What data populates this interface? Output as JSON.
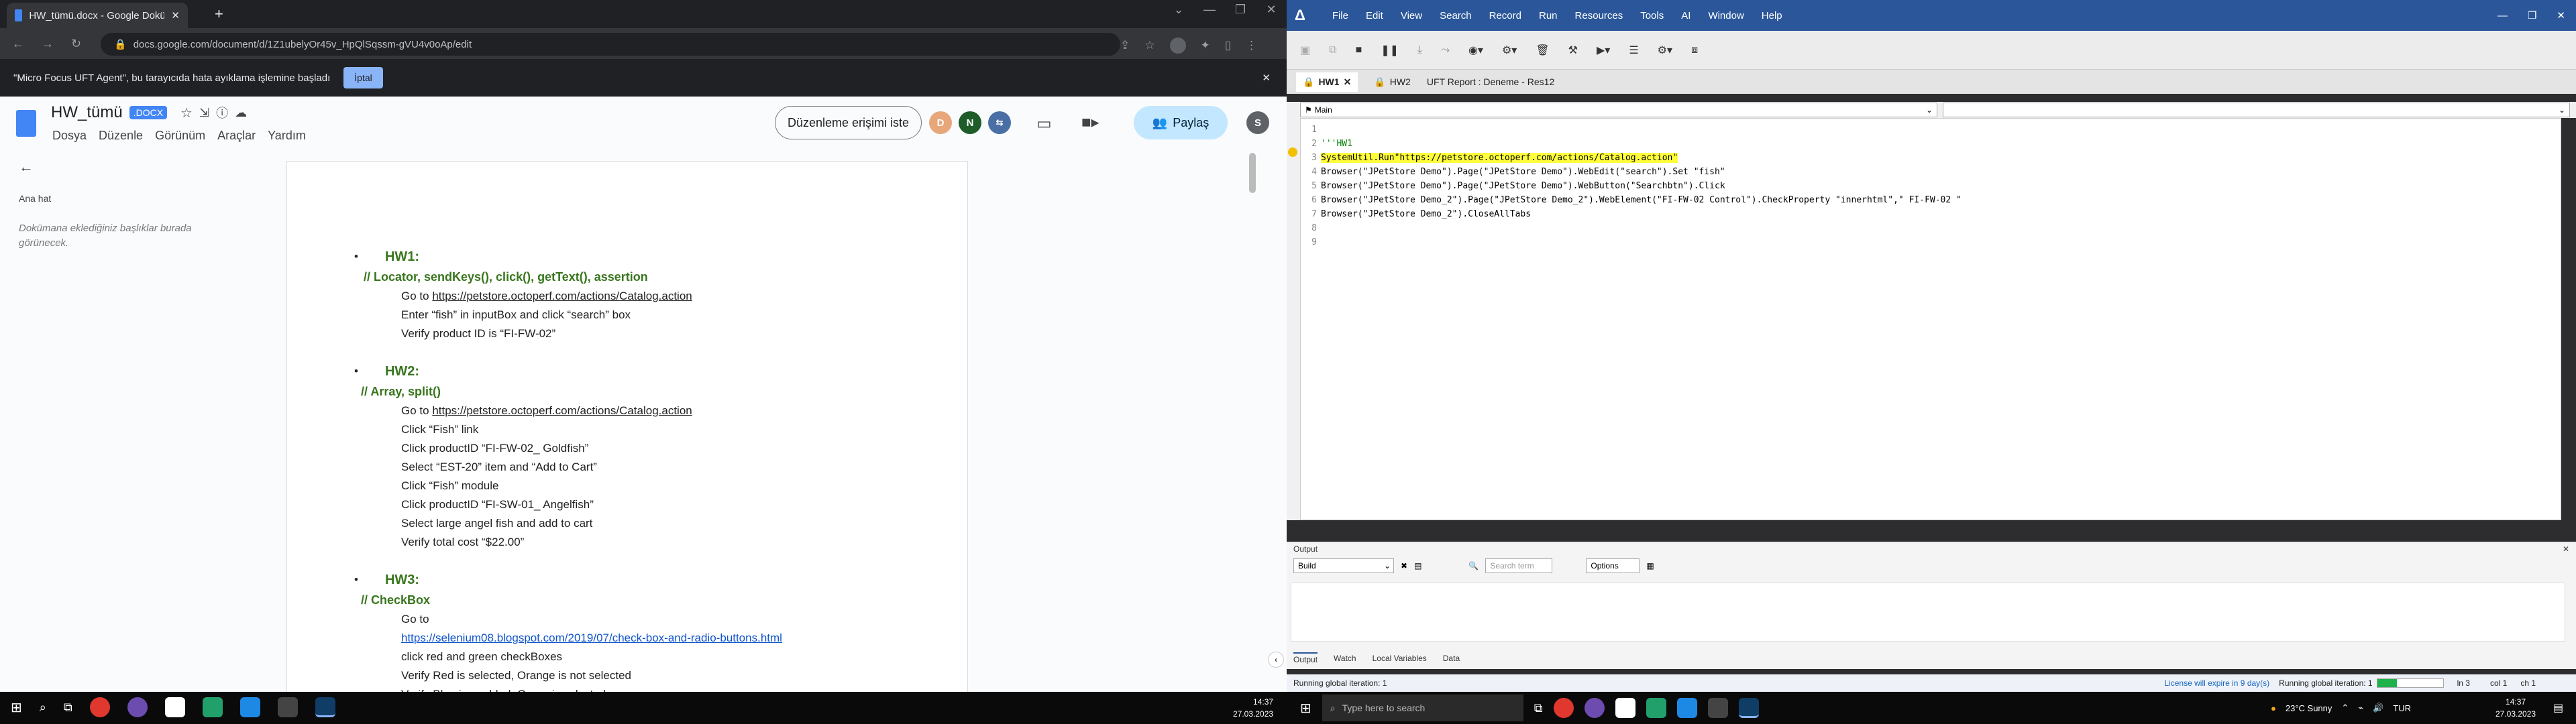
{
  "chrome": {
    "tab_title": "HW_tümü.docx - Google Dokümanlar",
    "url": "docs.google.com/document/d/1Z1ubelyOr45v_HpQlSqssm-gVU4v0oAp/edit",
    "infobar_text": "\"Micro Focus UFT Agent\", bu tarayıcıda hata ayıklama işlemine başladı",
    "infobar_cancel": "İptal"
  },
  "docs": {
    "doc_title": "HW_tümü",
    "doc_badge": ".DOCX",
    "menu": [
      "Dosya",
      "Düzenle",
      "Görünüm",
      "Araçlar",
      "Yardım"
    ],
    "request_edit": "Düzenleme erişimi iste",
    "share": "Paylaş",
    "avatar_d": "D",
    "avatar_n": "N",
    "avatar_s": "S",
    "outline_label": "Ana hat",
    "outline_hint": "Dokümana eklediğiniz başlıklar burada görünecek."
  },
  "document": {
    "hw1_title": "HW1:",
    "hw1_sub": "// Locator, sendKeys(), click(), getText(), assertion",
    "hw1_lines": [
      "Go to ",
      "Enter “fish” in inputBox and click “search” box",
      "Verify product ID is “FI-FW-02”"
    ],
    "hw1_link": "https://petstore.octoperf.com/actions/Catalog.action",
    "hw2_title": "HW2:",
    "hw2_sub": "// Array, split()",
    "hw2_goto": "Go to ",
    "hw2_link": "https://petstore.octoperf.com/actions/Catalog.action",
    "hw2_lines": [
      "Click “Fish” link",
      "Click productID “FI-FW-02_ Goldfish”",
      "Select “EST-20” item and “Add to Cart”",
      "Click “Fish” module",
      "Click productID “FI-SW-01_ Angelfish”",
      "Select large angel fish and add to cart",
      "Verify total cost “$22.00”"
    ],
    "hw3_title": "HW3:",
    "hw3_sub": "// CheckBox",
    "hw3_goto": "Go to",
    "hw3_link": "https://selenium08.blogspot.com/2019/07/check-box-and-radio-buttons.html",
    "hw3_lines": [
      "click red and green checkBoxes",
      "Verify Red is selected, Orange is not selected",
      "Verify Blue is enabled, Green is selected"
    ]
  },
  "uft": {
    "menu": [
      "File",
      "Edit",
      "View",
      "Search",
      "Record",
      "Run",
      "Resources",
      "Tools",
      "AI",
      "Window",
      "Help"
    ],
    "tabs": [
      "HW1",
      "HW2",
      "UFT Report : Deneme - Res12"
    ],
    "action_select": "Main",
    "code_lines": [
      {
        "n": "1",
        "t": ""
      },
      {
        "n": "2",
        "t": "'''HW1"
      },
      {
        "n": "3",
        "t": "SystemUtil.Run\"https://petstore.octoperf.com/actions/Catalog.action\""
      },
      {
        "n": "4",
        "t": "Browser(\"JPetStore Demo\").Page(\"JPetStore Demo\").WebEdit(\"search\").Set \"fish\""
      },
      {
        "n": "5",
        "t": "Browser(\"JPetStore Demo\").Page(\"JPetStore Demo\").WebButton(\"Searchbtn\").Click"
      },
      {
        "n": "6",
        "t": "Browser(\"JPetStore Demo_2\").Page(\"JPetStore Demo_2\").WebElement(\"FI-FW-02 Control\").CheckProperty \"innerhtml\",\" FI-FW-02 \""
      },
      {
        "n": "7",
        "t": "Browser(\"JPetStore Demo_2\").CloseAllTabs"
      },
      {
        "n": "8",
        "t": ""
      },
      {
        "n": "9",
        "t": ""
      }
    ],
    "output_title": "Output",
    "output_select": "Build",
    "search_placeholder": "Search term",
    "options_label": "Options",
    "bottom_tabs": [
      "Output",
      "Watch",
      "Local Variables",
      "Data"
    ],
    "status_left": "Running global iteration: 1",
    "license_text": "License will expire in 9 day(s)",
    "status_iter": "Running global iteration: 1",
    "status_ln": "ln 3",
    "status_col": "col 1",
    "status_ch": "ch 1"
  },
  "taskbar": {
    "left_time": "14:37",
    "left_date": "27.03.2023",
    "search_placeholder": "Type here to search",
    "weather": "23°C  Sunny",
    "lang": "TUR",
    "right_time": "14:37",
    "right_date": "27.03.2023"
  }
}
